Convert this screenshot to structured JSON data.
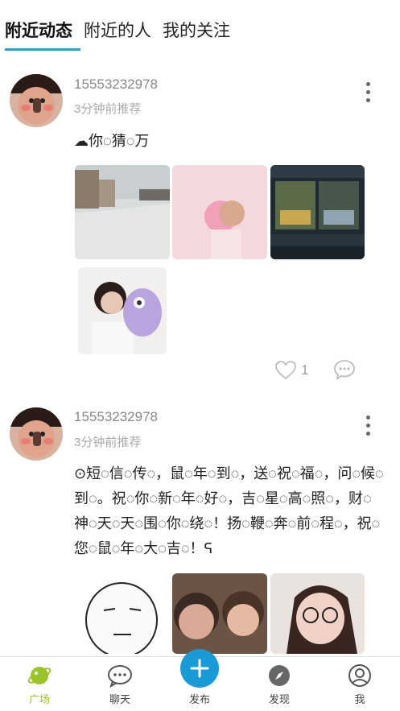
{
  "tabs": [
    {
      "label": "附近动态",
      "active": true
    },
    {
      "label": "附近的人",
      "active": false
    },
    {
      "label": "我的关注",
      "active": false
    }
  ],
  "posts": [
    {
      "username": "15553232978",
      "time": "3分钟前推荐",
      "text": "☁你◌猜◌万",
      "likes": "1"
    },
    {
      "username": "15553232978",
      "time": "3分钟前推荐",
      "text": "⊙短◌信◌传◌，鼠◌年◌到◌，送◌祝◌福◌，问◌候◌到◌。祝◌你◌新◌年◌好◌，吉◌星◌高◌照◌，财◌神◌天◌天◌围◌你◌绕◌！扬◌鞭◌奔◌前◌程◌，祝◌您◌鼠◌年◌大◌吉◌！ᕋ"
    }
  ],
  "bottom_nav": {
    "square": "广场",
    "chat": "聊天",
    "publish": "发布",
    "discover": "发现",
    "me": "我"
  },
  "colors": {
    "accent": "#2aa3d3",
    "active_nav": "#9ac22a",
    "fab": "#1a9ad6"
  }
}
